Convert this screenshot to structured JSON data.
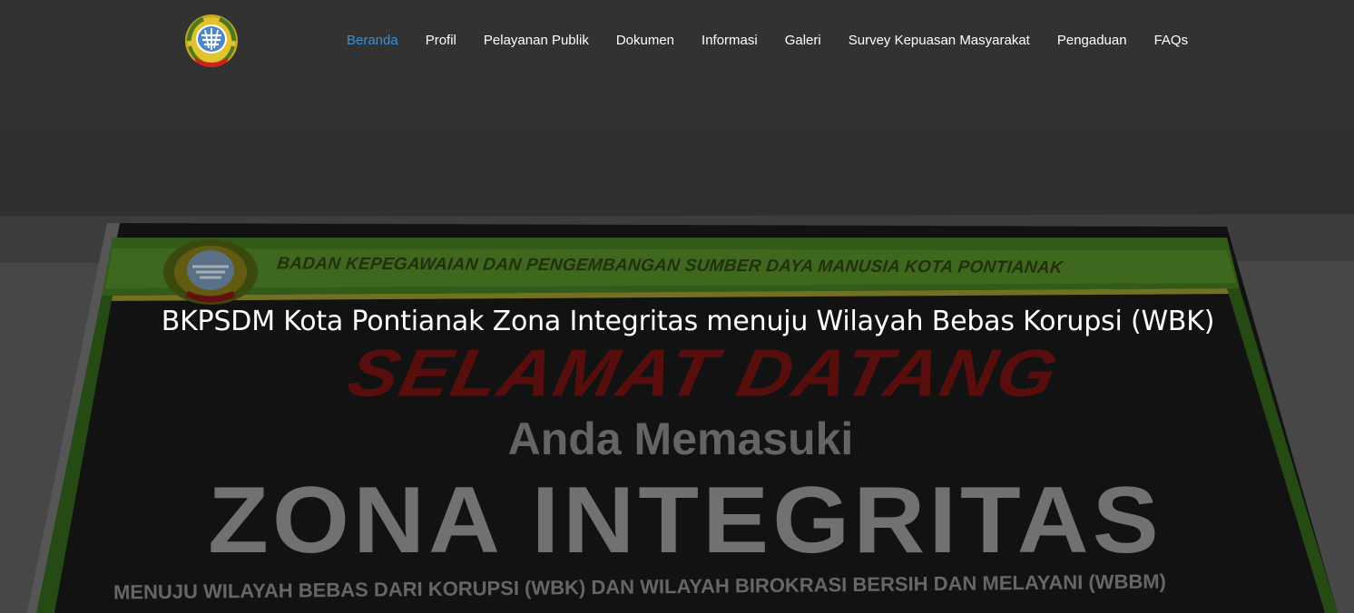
{
  "site": {
    "logo_name": "Kota Pontianak emblem",
    "logo_text": "KOTA PONTIANAK"
  },
  "nav": {
    "items": [
      {
        "label": "Beranda",
        "active": true
      },
      {
        "label": "Profil",
        "active": false
      },
      {
        "label": "Pelayanan Publik",
        "active": false
      },
      {
        "label": "Dokumen",
        "active": false
      },
      {
        "label": "Informasi",
        "active": false
      },
      {
        "label": "Galeri",
        "active": false
      },
      {
        "label": "Survey Kepuasan Masyarakat",
        "active": false
      },
      {
        "label": "Pengaduan",
        "active": false
      },
      {
        "label": "FAQs",
        "active": false
      }
    ]
  },
  "hero": {
    "title": "BKPSDM Kota Pontianak Zona Integritas menuju Wilayah Bebas Korupsi (WBK)",
    "banner": {
      "header": "BADAN KEPEGAWAIAN DAN PENGEMBANGAN SUMBER DAYA MANUSIA KOTA PONTIANAK",
      "welcome": "SELAMAT DATANG",
      "enter": "Anda Memasuki",
      "zone": "ZONA INTEGRITAS",
      "bottom": "MENUJU WILAYAH BEBAS DARI KORUPSI  (WBK) DAN WILAYAH BIROKRASI BERSIH DAN MELAYANI (WBBM)"
    }
  },
  "colors": {
    "nav_active": "#3b8fd6",
    "nav_text": "#ffffff",
    "banner_green": "#3f7a1e",
    "banner_dark": "#151515"
  }
}
